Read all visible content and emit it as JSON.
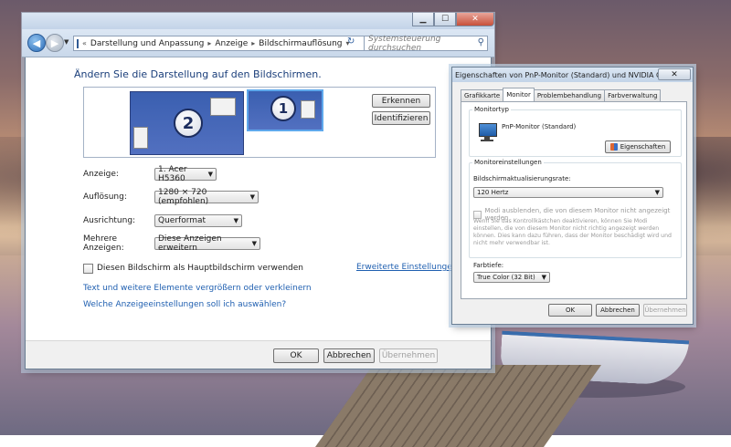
{
  "window": {
    "breadcrumb": [
      "Darstellung und Anpassung",
      "Anzeige",
      "Bildschirmauflösung"
    ],
    "search_placeholder": "Systemsteuerung durchsuchen",
    "heading": "Ändern Sie die Darstellung auf den Bildschirmen.",
    "monitor_numbers": {
      "second": "2",
      "first": "1"
    },
    "detect_button": "Erkennen",
    "identify_button": "Identifizieren",
    "display_label": "Anzeige:",
    "display_value": "1. Acer H5360",
    "resolution_label": "Auflösung:",
    "resolution_value": "1280 × 720 (empfohlen)",
    "orientation_label": "Ausrichtung:",
    "orientation_value": "Querformat",
    "multiple_label": "Mehrere Anzeigen:",
    "multiple_value": "Diese Anzeigen erweitern",
    "main_display_checkbox": "Diesen Bildschirm als Hauptbildschirm verwenden",
    "advanced_link": "Erweiterte Einstellungen",
    "text_size_link": "Text und weitere Elemente vergrößern oder verkleinern",
    "which_settings_link": "Welche Anzeigeeinstellungen soll ich auswählen?",
    "ok": "OK",
    "cancel": "Abbrechen",
    "apply": "Übernehmen"
  },
  "dialog": {
    "title": "Eigenschaften von PnP-Monitor (Standard) und NVIDIA GeFo...",
    "close": "✕",
    "tabs": [
      "Grafikkarte",
      "Monitor",
      "Problembehandlung",
      "Farbverwaltung"
    ],
    "selected_tab": "Monitor",
    "monitor_type_group": "Monitortyp",
    "monitor_name": "PnP-Monitor (Standard)",
    "properties_button": "Eigenschaften",
    "monitor_settings_group": "Monitoreinstellungen",
    "refresh_label": "Bildschirmaktualisierungsrate:",
    "refresh_value": "120 Hertz",
    "hide_modes_checkbox": "Modi ausblenden, die von diesem Monitor nicht angezeigt werden",
    "hide_modes_help": "Wenn Sie das Kontrollkästchen deaktivieren, können Sie Modi einstellen, die von diesem Monitor nicht richtig angezeigt werden können. Dies kann dazu führen, dass der Monitor beschädigt wird und nicht mehr verwendbar ist.",
    "color_depth_label": "Farbtiefe:",
    "color_depth_value": "True Color (32 Bit)",
    "ok": "OK",
    "cancel": "Abbrechen",
    "apply": "Übernehmen"
  }
}
